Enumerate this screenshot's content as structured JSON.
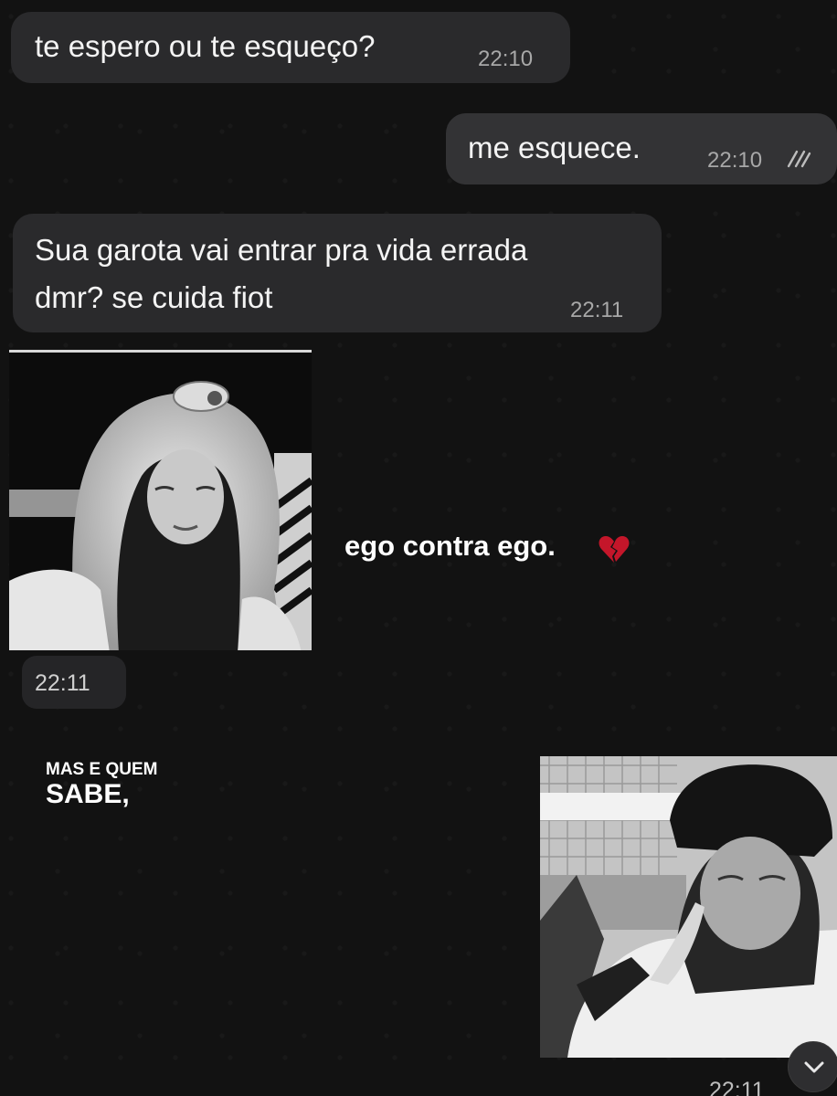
{
  "messages": [
    {
      "text": "te espero ou te esqueço?",
      "time": "22:10",
      "direction": "incoming"
    },
    {
      "text": "me esquece.",
      "time": "22:10",
      "direction": "outgoing",
      "status_icon": "double-check-icon"
    },
    {
      "lines": [
        "Sua garota vai entrar pra vida errada",
        "dmr? se cuida fiot"
      ],
      "time": "22:11",
      "direction": "incoming"
    }
  ],
  "image_message": {
    "time": "22:11",
    "caption": "ego contra ego.",
    "caption_icon": "broken-heart-icon"
  },
  "overlay_text": {
    "line1": "MAS E QUEM",
    "line2": "SABE,"
  },
  "bottom_time": "22:11",
  "scroll_button_icon": "chevron-down-icon",
  "colors": {
    "background": "#121212",
    "incoming_bubble": "#2a2a2c",
    "outgoing_bubble": "#333335",
    "timestamp": "#a8a8a8",
    "heart": "#c4162a"
  }
}
